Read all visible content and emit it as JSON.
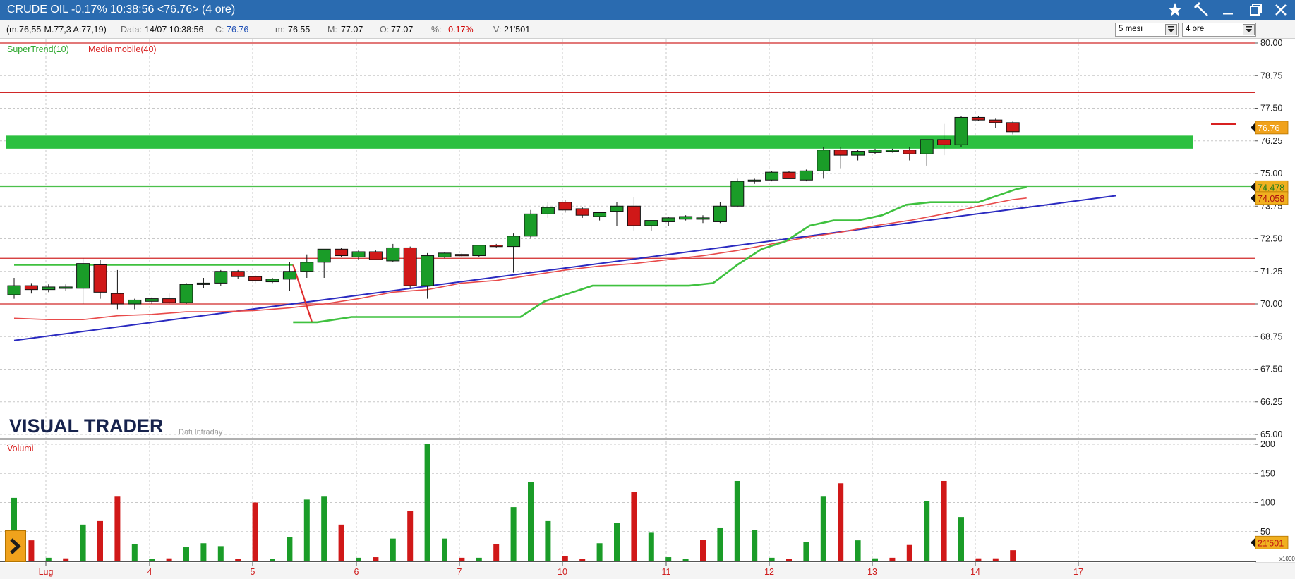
{
  "window": {
    "title": "CRUDE OIL -0.17% 10:38:56  <76.76> (4 ore)",
    "controls": [
      "star-icon",
      "pin-icon",
      "minimize-icon",
      "restore-icon",
      "close-icon"
    ]
  },
  "infobar": {
    "range": "(m.76,55-M.77,3 A:77,19)",
    "data_label": "Data:",
    "data_value": "14/07 10:38:56",
    "c_label": "C:",
    "c_value": "76.76",
    "m_label": "m:",
    "m_value": "76.55",
    "M_label": "M:",
    "M_value": "77.07",
    "o_label": "O:",
    "o_value": "77.07",
    "pct_label": "%:",
    "pct_value": "-0.17%",
    "v_label": "V:",
    "v_value": "21'501",
    "period_select": "5 mesi",
    "interval_select": "4 ore"
  },
  "indicators": {
    "supertrend": "SuperTrend(10)",
    "moving_average": "Media mobile(40)",
    "volumes_label": "Volumi"
  },
  "branding": {
    "logo": "VISUAL TRADER",
    "subtitle": "Dati Intraday"
  },
  "colors": {
    "up": "#1a9c28",
    "down": "#d01818",
    "supertrend": "#3fc13f",
    "moving_average": "#e84a4a",
    "trendline": "#2a2ac0",
    "zone": "#2cc040",
    "last_price_badge": "#f0a21c",
    "titlebar": "#2a6bb0"
  },
  "chart_data": {
    "type": "candlestick",
    "price_axis": {
      "ticks": [
        "80.00",
        "78.75",
        "77.50",
        "76.25",
        "75.00",
        "73.75",
        "72.50",
        "71.25",
        "70.00",
        "68.75",
        "67.50",
        "66.25",
        "65.00"
      ],
      "ylim": [
        65,
        80
      ]
    },
    "volume_axis": {
      "ticks": [
        "200",
        "150",
        "100",
        "50"
      ],
      "ylim": [
        0,
        200
      ],
      "multiplier_label": "x1000"
    },
    "x_labels": [
      "Lug",
      "4",
      "5",
      "6",
      "7",
      "10",
      "11",
      "12",
      "13",
      "14",
      "17"
    ],
    "badges": {
      "last_price": "76.76",
      "supertrend_value": "74.478",
      "ma_value": "74.058",
      "volume_value": "21'501"
    },
    "horizontal_lines": [
      80.0,
      78.1,
      74.5,
      71.75,
      70.0
    ],
    "zone": [
      75.95,
      76.45
    ],
    "candles": [
      {
        "o": 70.35,
        "h": 71.0,
        "l": 70.2,
        "c": 70.7
      },
      {
        "o": 70.7,
        "h": 70.8,
        "l": 70.4,
        "c": 70.55
      },
      {
        "o": 70.55,
        "h": 70.75,
        "l": 70.45,
        "c": 70.65
      },
      {
        "o": 70.6,
        "h": 70.75,
        "l": 70.5,
        "c": 70.65
      },
      {
        "o": 70.6,
        "h": 71.75,
        "l": 70.0,
        "c": 71.55
      },
      {
        "o": 71.5,
        "h": 71.7,
        "l": 70.2,
        "c": 70.45
      },
      {
        "o": 70.4,
        "h": 71.3,
        "l": 69.8,
        "c": 70.0
      },
      {
        "o": 70.0,
        "h": 70.2,
        "l": 69.8,
        "c": 70.15
      },
      {
        "o": 70.1,
        "h": 70.25,
        "l": 70.0,
        "c": 70.2
      },
      {
        "o": 70.2,
        "h": 70.4,
        "l": 70.0,
        "c": 70.05
      },
      {
        "o": 70.05,
        "h": 70.8,
        "l": 70.0,
        "c": 70.75
      },
      {
        "o": 70.75,
        "h": 71.0,
        "l": 70.6,
        "c": 70.8
      },
      {
        "o": 70.8,
        "h": 71.3,
        "l": 70.7,
        "c": 71.25
      },
      {
        "o": 71.25,
        "h": 71.3,
        "l": 70.95,
        "c": 71.05
      },
      {
        "o": 71.05,
        "h": 71.1,
        "l": 70.8,
        "c": 70.9
      },
      {
        "o": 70.85,
        "h": 71.0,
        "l": 70.8,
        "c": 70.95
      },
      {
        "o": 70.95,
        "h": 71.6,
        "l": 70.5,
        "c": 71.25
      },
      {
        "o": 71.25,
        "h": 71.9,
        "l": 71.0,
        "c": 71.6
      },
      {
        "o": 71.6,
        "h": 72.1,
        "l": 71.0,
        "c": 72.1
      },
      {
        "o": 72.1,
        "h": 72.15,
        "l": 71.8,
        "c": 71.85
      },
      {
        "o": 71.8,
        "h": 72.05,
        "l": 71.7,
        "c": 72.0
      },
      {
        "o": 72.0,
        "h": 72.05,
        "l": 71.7,
        "c": 71.7
      },
      {
        "o": 71.65,
        "h": 72.3,
        "l": 71.6,
        "c": 72.15
      },
      {
        "o": 72.15,
        "h": 72.2,
        "l": 70.6,
        "c": 70.7
      },
      {
        "o": 70.7,
        "h": 71.95,
        "l": 70.2,
        "c": 71.85
      },
      {
        "o": 71.8,
        "h": 72.0,
        "l": 71.75,
        "c": 71.95
      },
      {
        "o": 71.9,
        "h": 71.95,
        "l": 71.8,
        "c": 71.85
      },
      {
        "o": 71.85,
        "h": 72.25,
        "l": 71.8,
        "c": 72.25
      },
      {
        "o": 72.25,
        "h": 72.3,
        "l": 72.15,
        "c": 72.2
      },
      {
        "o": 72.2,
        "h": 72.7,
        "l": 71.2,
        "c": 72.6
      },
      {
        "o": 72.6,
        "h": 73.6,
        "l": 72.5,
        "c": 73.45
      },
      {
        "o": 73.45,
        "h": 73.9,
        "l": 73.3,
        "c": 73.7
      },
      {
        "o": 73.9,
        "h": 74.0,
        "l": 73.5,
        "c": 73.6
      },
      {
        "o": 73.65,
        "h": 73.7,
        "l": 73.3,
        "c": 73.4
      },
      {
        "o": 73.35,
        "h": 73.5,
        "l": 73.2,
        "c": 73.5
      },
      {
        "o": 73.55,
        "h": 73.9,
        "l": 73.0,
        "c": 73.75
      },
      {
        "o": 73.75,
        "h": 74.1,
        "l": 72.8,
        "c": 73.0
      },
      {
        "o": 73.0,
        "h": 73.2,
        "l": 72.8,
        "c": 73.2
      },
      {
        "o": 73.15,
        "h": 73.35,
        "l": 73.0,
        "c": 73.3
      },
      {
        "o": 73.25,
        "h": 73.4,
        "l": 73.2,
        "c": 73.35
      },
      {
        "o": 73.3,
        "h": 73.4,
        "l": 73.1,
        "c": 73.3
      },
      {
        "o": 73.15,
        "h": 73.9,
        "l": 73.1,
        "c": 73.75
      },
      {
        "o": 73.75,
        "h": 74.8,
        "l": 73.7,
        "c": 74.7
      },
      {
        "o": 74.7,
        "h": 74.8,
        "l": 74.6,
        "c": 74.75
      },
      {
        "o": 74.75,
        "h": 75.1,
        "l": 74.7,
        "c": 75.05
      },
      {
        "o": 75.05,
        "h": 75.1,
        "l": 74.8,
        "c": 74.8
      },
      {
        "o": 74.75,
        "h": 75.15,
        "l": 74.7,
        "c": 75.1
      },
      {
        "o": 75.1,
        "h": 76.0,
        "l": 74.8,
        "c": 75.9
      },
      {
        "o": 75.9,
        "h": 76.0,
        "l": 75.2,
        "c": 75.7
      },
      {
        "o": 75.7,
        "h": 75.9,
        "l": 75.5,
        "c": 75.85
      },
      {
        "o": 75.8,
        "h": 75.95,
        "l": 75.75,
        "c": 75.9
      },
      {
        "o": 75.85,
        "h": 75.95,
        "l": 75.8,
        "c": 75.9
      },
      {
        "o": 75.9,
        "h": 76.0,
        "l": 75.5,
        "c": 75.75
      },
      {
        "o": 75.75,
        "h": 76.3,
        "l": 75.3,
        "c": 76.3
      },
      {
        "o": 76.3,
        "h": 76.9,
        "l": 75.7,
        "c": 76.1
      },
      {
        "o": 76.1,
        "h": 77.2,
        "l": 76.0,
        "c": 77.15
      },
      {
        "o": 77.15,
        "h": 77.2,
        "l": 77.0,
        "c": 77.05
      },
      {
        "o": 77.05,
        "h": 77.1,
        "l": 76.75,
        "c": 76.95
      },
      {
        "o": 76.95,
        "h": 77.0,
        "l": 76.5,
        "c": 76.6
      }
    ],
    "volumes": [
      {
        "x": 1,
        "v": 108,
        "up": true
      },
      {
        "x": 2,
        "v": 35,
        "up": false
      },
      {
        "x": 3,
        "v": 5,
        "up": true
      },
      {
        "x": 4,
        "v": 4,
        "up": false
      },
      {
        "x": 5,
        "v": 62,
        "up": true
      },
      {
        "x": 6,
        "v": 68,
        "up": false
      },
      {
        "x": 7,
        "v": 110,
        "up": false
      },
      {
        "x": 8,
        "v": 28,
        "up": true
      },
      {
        "x": 9,
        "v": 3,
        "up": true
      },
      {
        "x": 10,
        "v": 4,
        "up": false
      },
      {
        "x": 11,
        "v": 23,
        "up": true
      },
      {
        "x": 12,
        "v": 30,
        "up": true
      },
      {
        "x": 13,
        "v": 25,
        "up": true
      },
      {
        "x": 14,
        "v": 3,
        "up": false
      },
      {
        "x": 15,
        "v": 100,
        "up": false
      },
      {
        "x": 16,
        "v": 3,
        "up": true
      },
      {
        "x": 17,
        "v": 40,
        "up": true
      },
      {
        "x": 18,
        "v": 105,
        "up": true
      },
      {
        "x": 19,
        "v": 110,
        "up": true
      },
      {
        "x": 20,
        "v": 62,
        "up": false
      },
      {
        "x": 21,
        "v": 5,
        "up": true
      },
      {
        "x": 22,
        "v": 6,
        "up": false
      },
      {
        "x": 23,
        "v": 38,
        "up": true
      },
      {
        "x": 24,
        "v": 85,
        "up": false
      },
      {
        "x": 25,
        "v": 200,
        "up": true
      },
      {
        "x": 26,
        "v": 38,
        "up": true
      },
      {
        "x": 27,
        "v": 5,
        "up": false
      },
      {
        "x": 28,
        "v": 5,
        "up": true
      },
      {
        "x": 29,
        "v": 28,
        "up": false
      },
      {
        "x": 30,
        "v": 92,
        "up": true
      },
      {
        "x": 31,
        "v": 135,
        "up": true
      },
      {
        "x": 32,
        "v": 68,
        "up": true
      },
      {
        "x": 33,
        "v": 8,
        "up": false
      },
      {
        "x": 34,
        "v": 3,
        "up": false
      },
      {
        "x": 35,
        "v": 30,
        "up": true
      },
      {
        "x": 36,
        "v": 65,
        "up": true
      },
      {
        "x": 37,
        "v": 118,
        "up": false
      },
      {
        "x": 38,
        "v": 48,
        "up": true
      },
      {
        "x": 39,
        "v": 6,
        "up": true
      },
      {
        "x": 40,
        "v": 3,
        "up": true
      },
      {
        "x": 41,
        "v": 36,
        "up": false
      },
      {
        "x": 42,
        "v": 57,
        "up": true
      },
      {
        "x": 43,
        "v": 137,
        "up": true
      },
      {
        "x": 44,
        "v": 53,
        "up": true
      },
      {
        "x": 45,
        "v": 5,
        "up": true
      },
      {
        "x": 46,
        "v": 3,
        "up": false
      },
      {
        "x": 47,
        "v": 32,
        "up": true
      },
      {
        "x": 48,
        "v": 110,
        "up": true
      },
      {
        "x": 49,
        "v": 133,
        "up": false
      },
      {
        "x": 50,
        "v": 35,
        "up": true
      },
      {
        "x": 51,
        "v": 4,
        "up": true
      },
      {
        "x": 52,
        "v": 5,
        "up": false
      },
      {
        "x": 53,
        "v": 27,
        "up": false
      },
      {
        "x": 54,
        "v": 102,
        "up": true
      },
      {
        "x": 55,
        "v": 137,
        "up": false
      },
      {
        "x": 56,
        "v": 75,
        "up": true
      },
      {
        "x": 57,
        "v": 4,
        "up": false
      },
      {
        "x": 58,
        "v": 4,
        "up": false
      },
      {
        "x": 59,
        "v": 18,
        "up": false
      }
    ],
    "trendline": [
      [
        0,
        68.6
      ],
      [
        64,
        74.15
      ]
    ],
    "supertrend_left": [
      [
        0,
        71.5
      ],
      [
        16.2,
        71.5
      ]
    ],
    "supertrend": [
      [
        16.2,
        69.3
      ],
      [
        17.6,
        69.3
      ],
      [
        19.6,
        69.5
      ],
      [
        29.4,
        69.5
      ],
      [
        30.8,
        70.1
      ],
      [
        33.6,
        70.7
      ],
      [
        39.2,
        70.7
      ],
      [
        40.6,
        70.8
      ],
      [
        42,
        71.5
      ],
      [
        43.4,
        72.1
      ],
      [
        44.8,
        72.4
      ],
      [
        46.2,
        73.0
      ],
      [
        47.6,
        73.2
      ],
      [
        49,
        73.2
      ],
      [
        50.4,
        73.4
      ],
      [
        51.8,
        73.8
      ],
      [
        53.2,
        73.9
      ],
      [
        56,
        73.9
      ],
      [
        58.2,
        74.4
      ],
      [
        58.8,
        74.48
      ]
    ],
    "moving_average": [
      [
        0,
        69.45
      ],
      [
        2,
        69.4
      ],
      [
        4,
        69.4
      ],
      [
        6,
        69.55
      ],
      [
        8,
        69.6
      ],
      [
        10,
        69.7
      ],
      [
        12,
        69.7
      ],
      [
        14,
        69.75
      ],
      [
        16,
        69.85
      ],
      [
        18,
        70.0
      ],
      [
        20,
        70.2
      ],
      [
        22,
        70.45
      ],
      [
        24,
        70.55
      ],
      [
        26,
        70.8
      ],
      [
        28,
        70.9
      ],
      [
        30,
        71.1
      ],
      [
        32,
        71.3
      ],
      [
        34,
        71.45
      ],
      [
        36,
        71.55
      ],
      [
        38,
        71.7
      ],
      [
        40,
        71.85
      ],
      [
        42,
        72.05
      ],
      [
        44,
        72.3
      ],
      [
        46,
        72.55
      ],
      [
        48,
        72.75
      ],
      [
        50,
        73.0
      ],
      [
        52,
        73.2
      ],
      [
        54,
        73.45
      ],
      [
        56,
        73.75
      ],
      [
        58,
        74.0
      ],
      [
        58.8,
        74.06
      ]
    ]
  }
}
